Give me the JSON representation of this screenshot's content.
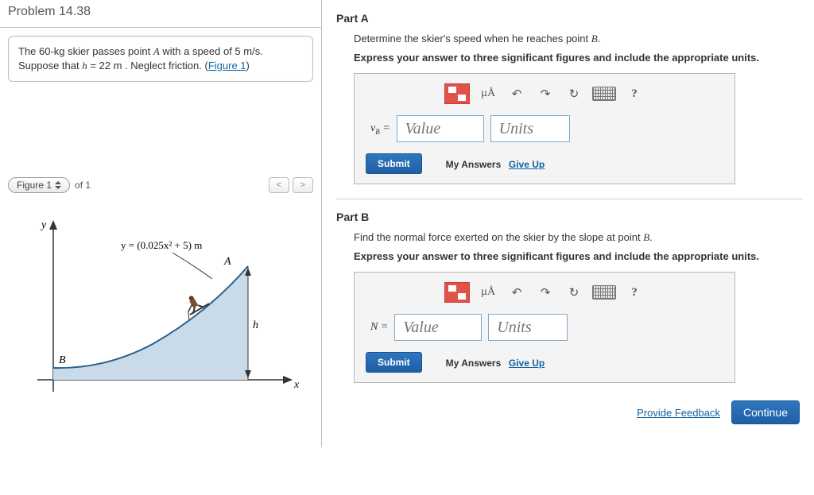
{
  "problem": {
    "title": "Problem 14.38",
    "text_pre": "The 60-kg skier passes point ",
    "A": "A",
    "text_mid1": " with a speed of 5 m/s. Suppose that ",
    "hvar": "h",
    "text_mid2": " = 22  m . Neglect friction. (",
    "figlink": "Figure 1",
    "text_post": ")"
  },
  "figure": {
    "btn_label": "Figure 1",
    "of_label": "of 1",
    "prev": "<",
    "next": ">",
    "ylabel": "y",
    "xlabel": "x",
    "curve_eq": "y = (0.025x² + 5) m",
    "A": "A",
    "B": "B",
    "h": "h"
  },
  "partA": {
    "title": "Part A",
    "desc_pre": "Determine the skier's speed when he reaches point ",
    "B": "B",
    "desc_post": ".",
    "instr": "Express your answer to three significant figures and include the appropriate units.",
    "mu": "µÅ",
    "help": "?",
    "var_label": "vB =",
    "value_ph": "Value",
    "units_ph": "Units",
    "submit": "Submit",
    "myanswers": "My Answers",
    "giveup": "Give Up"
  },
  "partB": {
    "title": "Part B",
    "desc_pre": "Find the normal force exerted on the skier by the slope at point ",
    "B": "B",
    "desc_post": ".",
    "instr": "Express your answer to three significant figures and include the appropriate units.",
    "mu": "µÅ",
    "help": "?",
    "var_label": "N =",
    "value_ph": "Value",
    "units_ph": "Units",
    "submit": "Submit",
    "myanswers": "My Answers",
    "giveup": "Give Up"
  },
  "footer": {
    "feedback": "Provide Feedback",
    "continue": "Continue"
  }
}
